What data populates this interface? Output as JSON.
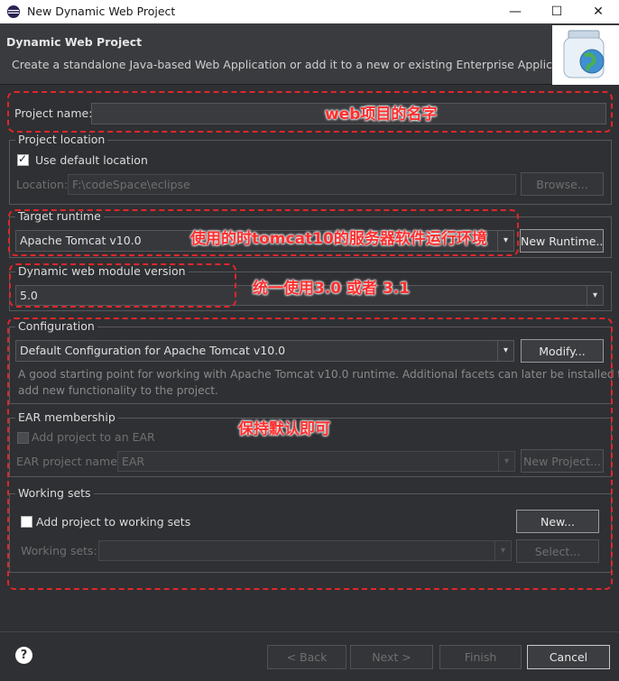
{
  "window": {
    "title": "New Dynamic Web Project",
    "minimize": "—",
    "maximize": "☐",
    "close": "✕"
  },
  "banner": {
    "heading": "Dynamic Web Project",
    "description": "Create a standalone Java-based Web Application or add it to a new or existing Enterprise Application."
  },
  "project_name": {
    "label": "Project name:",
    "value": ""
  },
  "project_location": {
    "group_title": "Project location",
    "use_default_label": "Use default location",
    "use_default_checked": true,
    "location_label": "Location:",
    "location_value": "F:\\codeSpace\\eclipse",
    "browse_label": "Browse..."
  },
  "target_runtime": {
    "group_title": "Target runtime",
    "value": "Apache Tomcat v10.0",
    "new_runtime_label": "New Runtime..."
  },
  "module_version": {
    "group_title": "Dynamic web module version",
    "value": "5.0"
  },
  "configuration": {
    "group_title": "Configuration",
    "value": "Default Configuration for Apache Tomcat v10.0",
    "modify_label": "Modify...",
    "description_line1": "A good starting point for working with Apache Tomcat v10.0 runtime. Additional facets can later be installed to",
    "description_line2": "add new functionality to the project."
  },
  "ear": {
    "group_title": "EAR membership",
    "add_label": "Add project to an EAR",
    "project_name_label": "EAR project name:",
    "project_name_value": "EAR",
    "new_project_label": "New Project..."
  },
  "working_sets": {
    "group_title": "Working sets",
    "add_label": "Add project to working sets",
    "new_label": "New...",
    "sets_label": "Working sets:",
    "select_label": "Select..."
  },
  "footer": {
    "help_icon": "?",
    "back_label": "< Back",
    "next_label": "Next >",
    "finish_label": "Finish",
    "cancel_label": "Cancel"
  },
  "annotations": {
    "project_name_note": "web项目的名字",
    "runtime_note": "使用的时tomcat10的服务器软件运行环境",
    "version_note": "统一使用3.0 或者 3.1",
    "keep_default_note": "保持默认即可",
    "color": "#e0262b"
  }
}
